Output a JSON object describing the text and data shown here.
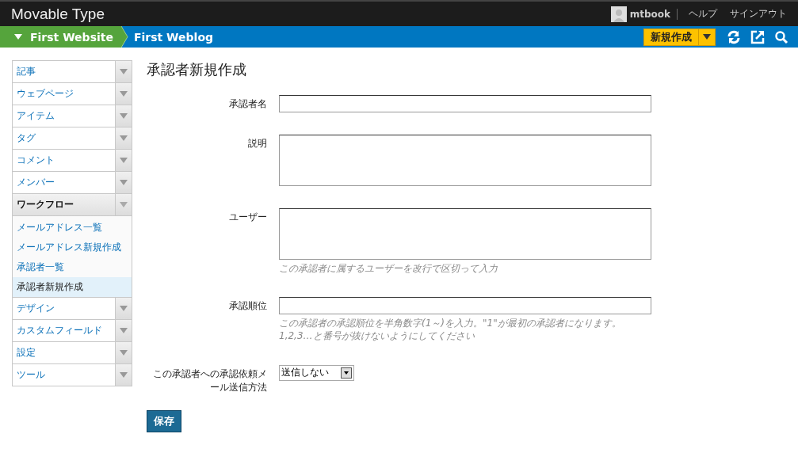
{
  "header": {
    "app_title": "Movable Type",
    "user": "mtbook",
    "links": [
      "ヘルプ",
      "サインアウト"
    ]
  },
  "breadcrumb": {
    "website": "First Website",
    "blog": "First Weblog",
    "new_button": "新規作成"
  },
  "sidebar": {
    "items": [
      {
        "label": "記事",
        "expanded": false
      },
      {
        "label": "ウェブページ",
        "expanded": false
      },
      {
        "label": "アイテム",
        "expanded": false
      },
      {
        "label": "タグ",
        "expanded": false
      },
      {
        "label": "コメント",
        "expanded": false
      },
      {
        "label": "メンバー",
        "expanded": false
      },
      {
        "label": "ワークフロー",
        "expanded": true,
        "children": [
          {
            "label": "メールアドレス一覧",
            "selected": false
          },
          {
            "label": "メールアドレス新規作成",
            "selected": false
          },
          {
            "label": "承認者一覧",
            "selected": false
          },
          {
            "label": "承認者新規作成",
            "selected": true
          }
        ]
      },
      {
        "label": "デザイン",
        "expanded": false
      },
      {
        "label": "カスタムフィールド",
        "expanded": false
      },
      {
        "label": "設定",
        "expanded": false
      },
      {
        "label": "ツール",
        "expanded": false
      }
    ]
  },
  "page_title": "承認者新規作成",
  "fields": [
    {
      "kind": "text",
      "label": "承認者名"
    },
    {
      "kind": "textarea",
      "label": "説明"
    },
    {
      "kind": "textarea",
      "label": "ユーザー",
      "hint": "この承認者に属するユーザーを改行で区切って入力"
    },
    {
      "kind": "text",
      "label": "承認順位",
      "hint": "この承認者の承認順位を半角数字(1～)を入力。\"1\"が最初の承認者になります。1,2,3…と番号が抜けないようにしてください"
    },
    {
      "kind": "select",
      "label": "この承認者への承認依頼メール送信方法",
      "value": "送信しない"
    }
  ],
  "save_button": "保存"
}
